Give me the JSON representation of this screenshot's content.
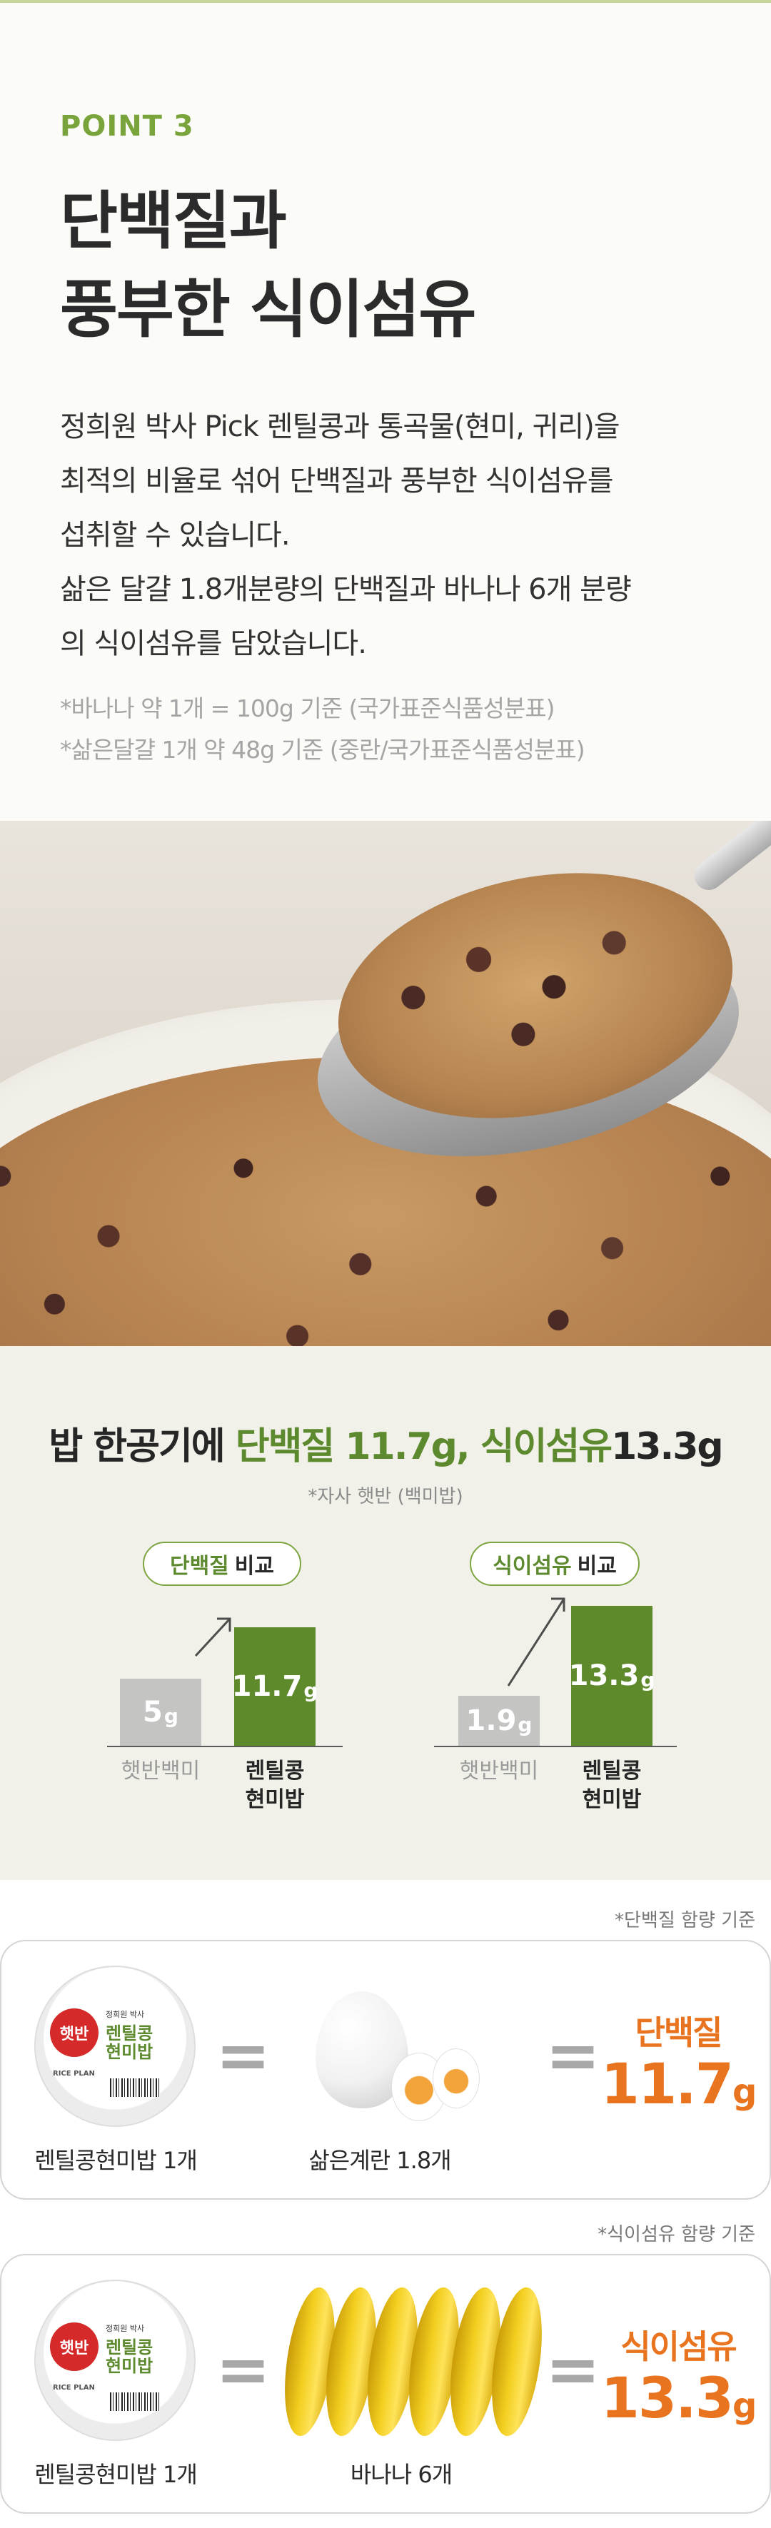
{
  "intro": {
    "point_label": "POINT 3",
    "headline_line1": "단백질과",
    "headline_line2": "풍부한 식이섬유",
    "body_lines": [
      "정희원 박사 Pick 렌틸콩과 통곡물(현미, 귀리)을",
      "최적의 비율로 섞어 단백질과 풍부한 식이섬유를",
      "섭취할 수 있습니다.",
      "삶은 달걀 1.8개분량의 단백질과  바나나 6개 분량",
      "의 식이섬유를 담았습니다."
    ],
    "notes": [
      "*바나나 약 1개 = 100g 기준 (국가표준식품성분표)",
      "*삶은달걀 1개 약 48g 기준 (중란/국가표준식품성분표)"
    ]
  },
  "comparison": {
    "title_prefix": "밥 한공기에 ",
    "title_highlight": "단백질 11.7g, 식이섬유",
    "title_suffix": "13.3g",
    "subtitle": "*자사 햇반 (백미밥)",
    "accent_color": "#5f8a2c",
    "groups": [
      {
        "pill_highlight": "단백질",
        "pill_rest": "비교",
        "bars": [
          {
            "value": "5",
            "unit": "g",
            "label": "햇반백미"
          },
          {
            "value": "11.7",
            "unit": "g",
            "label_line1": "렌틸콩",
            "label_line2": "현미밥"
          }
        ]
      },
      {
        "pill_highlight": "식이섬유",
        "pill_rest": "비교",
        "bars": [
          {
            "value": "1.9",
            "unit": "g",
            "label": "햇반백미"
          },
          {
            "value": "13.3",
            "unit": "g",
            "label_line1": "렌틸콩",
            "label_line2": "현미밥"
          }
        ]
      }
    ]
  },
  "equivalence": {
    "result_color": "#e9741f",
    "cards": [
      {
        "basis": "*단백질 함량 기준",
        "product": {
          "badge": "햇반",
          "maker": "정희원 박사",
          "name_line1": "렌틸콩",
          "name_line2": "현미밥",
          "brand": "RICE PLAN"
        },
        "product_label": "렌틸콩현미밥 1개",
        "equals": "=",
        "item_label": "삶은계란 1.8개",
        "result_label": "단백질",
        "result_number": "11.7",
        "result_unit": "g",
        "item_icon": "boiled-egg-icon"
      },
      {
        "basis": "*식이섬유 함량 기준",
        "product": {
          "badge": "햇반",
          "maker": "정희원 박사",
          "name_line1": "렌틸콩",
          "name_line2": "현미밥",
          "brand": "RICE PLAN"
        },
        "product_label": "렌틸콩현미밥 1개",
        "equals": "=",
        "item_label": "바나나 6개",
        "result_label": "식이섬유",
        "result_number": "13.3",
        "result_unit": "g",
        "item_icon": "banana-icon"
      }
    ]
  }
}
